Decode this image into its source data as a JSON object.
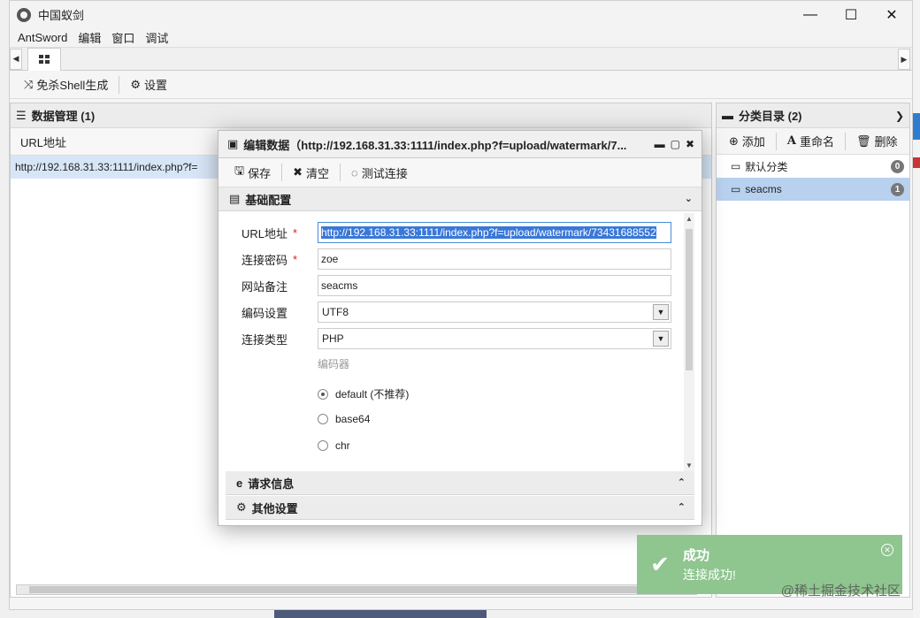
{
  "window": {
    "title": "中国蚁剑",
    "minimize_glyph": "—",
    "maximize_glyph": "☐",
    "close_glyph": "✕"
  },
  "menu": {
    "items": [
      "AntSword",
      "编辑",
      "窗口",
      "调试"
    ]
  },
  "tabbar": {
    "left_arrow": "◀",
    "right_arrow": "▶",
    "home_icon": "grid-icon"
  },
  "toolbar": {
    "shell_gen_label": "免杀Shell生成",
    "settings_label": "设置"
  },
  "data_panel": {
    "title": "数据管理 (1)",
    "column_url": "URL地址",
    "row_url": "http://192.168.31.33:1111/index.php?f="
  },
  "category_panel": {
    "title": "分类目录 (2)",
    "add_label": "添加",
    "rename_label": "重命名",
    "delete_label": "删除",
    "items": [
      {
        "name": "默认分类",
        "count": "0"
      },
      {
        "name": "seacms",
        "count": "1"
      }
    ]
  },
  "dialog": {
    "title": "编辑数据（http://192.168.31.33:1111/index.php?f=upload/watermark/7...",
    "save_label": "保存",
    "clear_label": "清空",
    "test_label": "测试连接",
    "section_basic": "基础配置",
    "section_request": "请求信息",
    "section_other": "其他设置",
    "fields": {
      "url_label": "URL地址",
      "url_value": "http://192.168.31.33:1111/index.php?f=upload/watermark/73431688552",
      "password_label": "连接密码",
      "password_value": "zoe",
      "note_label": "网站备注",
      "note_value": "seacms",
      "encoding_label": "编码设置",
      "encoding_value": "UTF8",
      "type_label": "连接类型",
      "type_value": "PHP",
      "encoder_label": "编码器",
      "encoders": [
        "default (不推荐)",
        "base64",
        "chr"
      ],
      "required_mark": "*"
    }
  },
  "toast": {
    "title": "成功",
    "message": "连接成功!",
    "color": "#8fc58f"
  },
  "watermark": "@稀土掘金技术社区"
}
